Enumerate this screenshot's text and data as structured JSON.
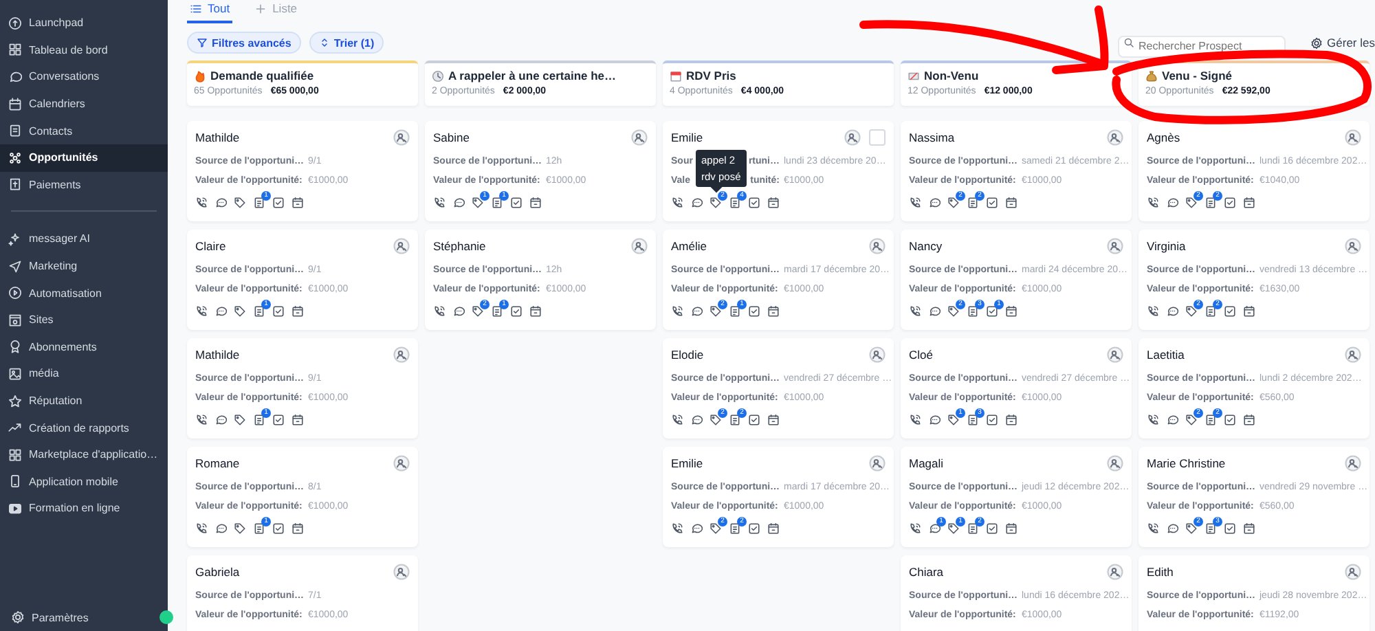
{
  "sidebar": {
    "groups": [
      [
        {
          "label": "Launchpad",
          "selected": false
        },
        {
          "label": "Tableau de bord",
          "selected": false
        },
        {
          "label": "Conversations",
          "selected": false
        },
        {
          "label": "Calendriers",
          "selected": false
        },
        {
          "label": "Contacts",
          "selected": false
        },
        {
          "label": "Opportunités",
          "selected": true
        },
        {
          "label": "Paiements",
          "selected": false
        }
      ],
      [
        {
          "label": "messager AI",
          "selected": false
        },
        {
          "label": "Marketing",
          "selected": false
        },
        {
          "label": "Automatisation",
          "selected": false
        },
        {
          "label": "Sites",
          "selected": false
        },
        {
          "label": "Abonnements",
          "selected": false
        },
        {
          "label": "média",
          "selected": false
        },
        {
          "label": "Réputation",
          "selected": false
        },
        {
          "label": "Création de rapports",
          "selected": false
        },
        {
          "label": "Marketplace d'applicatio…",
          "selected": false
        },
        {
          "label": "Application mobile",
          "selected": false
        },
        {
          "label": "Formation en ligne",
          "selected": false
        }
      ]
    ],
    "footer": {
      "label": "Paramètres"
    }
  },
  "tabs": [
    {
      "label": "Tout",
      "selected": true
    },
    {
      "label": "Liste",
      "selected": false
    }
  ],
  "toolbar": {
    "filters": "Filtres avancés",
    "sort": "Trier (1)",
    "search": {
      "placeholder": "Rechercher Prospect"
    },
    "manage": "Gérer les"
  },
  "columns": [
    {
      "title": "Demande qualifiée",
      "count": "65 Opportunités",
      "amount": "€65 000,00",
      "color": "#f4d57e",
      "cards": [
        {
          "name": "Mathilde",
          "source_label": "Source de l'opportuni…",
          "source": "9/1",
          "value_label": "Valeur de l'opportunité:",
          "value": "€1000,00",
          "actions": [
            {
              "kind": "call"
            },
            {
              "kind": "message"
            },
            {
              "kind": "tag"
            },
            {
              "kind": "note",
              "badge": "1"
            },
            {
              "kind": "task"
            },
            {
              "kind": "appointment"
            }
          ]
        },
        {
          "name": "Claire",
          "source_label": "Source de l'opportuni…",
          "source": "9/1",
          "value_label": "Valeur de l'opportunité:",
          "value": "€1000,00",
          "actions": [
            {
              "kind": "call"
            },
            {
              "kind": "message"
            },
            {
              "kind": "tag"
            },
            {
              "kind": "note",
              "badge": "1"
            },
            {
              "kind": "task"
            },
            {
              "kind": "appointment"
            }
          ]
        },
        {
          "name": "Mathilde",
          "source_label": "Source de l'opportuni…",
          "source": "9/1",
          "value_label": "Valeur de l'opportunité:",
          "value": "€1000,00",
          "actions": [
            {
              "kind": "call"
            },
            {
              "kind": "message"
            },
            {
              "kind": "tag"
            },
            {
              "kind": "note",
              "badge": "1"
            },
            {
              "kind": "task"
            },
            {
              "kind": "appointment"
            }
          ]
        },
        {
          "name": "Romane",
          "source_label": "Source de l'opportuni…",
          "source": "8/1",
          "value_label": "Valeur de l'opportunité:",
          "value": "€1000,00",
          "actions": [
            {
              "kind": "call"
            },
            {
              "kind": "message"
            },
            {
              "kind": "tag"
            },
            {
              "kind": "note",
              "badge": "1"
            },
            {
              "kind": "task"
            },
            {
              "kind": "appointment"
            }
          ]
        },
        {
          "name": "Gabriela",
          "source_label": "Source de l'opportuni…",
          "source": "7/1",
          "value_label": "Valeur de l'opportunité:",
          "value": "€1000,00"
        }
      ]
    },
    {
      "title": "A rappeler à une certaine he…",
      "count": "2 Opportunités",
      "amount": "€2 000,00",
      "color": "#c9d0dc",
      "cards": [
        {
          "name": "Sabine",
          "source_label": "Source de l'opportuni…",
          "source": "12h",
          "value_label": "Valeur de l'opportunité:",
          "value": "€1000,00",
          "actions": [
            {
              "kind": "call"
            },
            {
              "kind": "message"
            },
            {
              "kind": "tag",
              "badge": "1"
            },
            {
              "kind": "note",
              "badge": "1"
            },
            {
              "kind": "task"
            },
            {
              "kind": "appointment"
            }
          ]
        },
        {
          "name": "Stéphanie",
          "source_label": "Source de l'opportuni…",
          "source": "12h",
          "value_label": "Valeur de l'opportunité:",
          "value": "€1000,00",
          "actions": [
            {
              "kind": "call"
            },
            {
              "kind": "message"
            },
            {
              "kind": "tag",
              "badge": "2"
            },
            {
              "kind": "note",
              "badge": "1"
            },
            {
              "kind": "task"
            },
            {
              "kind": "appointment"
            }
          ]
        }
      ]
    },
    {
      "title": "RDV Pris",
      "count": "4 Opportunités",
      "amount": "€4 000,00",
      "color": "#b9c8e6",
      "cards": [
        {
          "name": "Emilie",
          "checkbox": {
            "checked": false
          },
          "tooltip": [
            "appel 2",
            "rdv posé"
          ],
          "source_label": [
            "Sour",
            "rtuni…"
          ],
          "source": "lundi 23 décembre 20…",
          "value_label": [
            "Vale",
            "tunité:"
          ],
          "value": "€1000,00",
          "actions": [
            {
              "kind": "call"
            },
            {
              "kind": "message"
            },
            {
              "kind": "tag",
              "badge": "2"
            },
            {
              "kind": "note",
              "badge": "4"
            },
            {
              "kind": "task"
            },
            {
              "kind": "appointment"
            }
          ]
        },
        {
          "name": "Amélie",
          "source_label": "Source de l'opportuni…",
          "source": "mardi 17 décembre 20…",
          "value_label": "Valeur de l'opportunité:",
          "value": "€1000,00",
          "actions": [
            {
              "kind": "call"
            },
            {
              "kind": "message"
            },
            {
              "kind": "tag",
              "badge": "2"
            },
            {
              "kind": "note",
              "badge": "1"
            },
            {
              "kind": "task"
            },
            {
              "kind": "appointment"
            }
          ]
        },
        {
          "name": "Elodie",
          "source_label": "Source de l'opportuni…",
          "source": "vendredi 27 décembre …",
          "value_label": "Valeur de l'opportunité:",
          "value": "€1000,00",
          "actions": [
            {
              "kind": "call"
            },
            {
              "kind": "message"
            },
            {
              "kind": "tag",
              "badge": "2"
            },
            {
              "kind": "note",
              "badge": "2"
            },
            {
              "kind": "task"
            },
            {
              "kind": "appointment"
            }
          ]
        },
        {
          "name": "Emilie",
          "source_label": "Source de l'opportuni…",
          "source": "mardi 17 décembre 20…",
          "value_label": "Valeur de l'opportunité:",
          "value": "€1000,00",
          "actions": [
            {
              "kind": "call"
            },
            {
              "kind": "message"
            },
            {
              "kind": "tag",
              "badge": "2"
            },
            {
              "kind": "note",
              "badge": "2"
            },
            {
              "kind": "task"
            },
            {
              "kind": "appointment"
            }
          ]
        }
      ]
    },
    {
      "title": "Non-Venu",
      "count": "12 Opportunités",
      "amount": "€12 000,00",
      "color": "#b9c8e6",
      "cards": [
        {
          "name": "Nassima",
          "source_label": "Source de l'opportuni…",
          "source": "samedi 21 décembre 2…",
          "value_label": "Valeur de l'opportunité:",
          "value": "€1000,00",
          "actions": [
            {
              "kind": "call"
            },
            {
              "kind": "message"
            },
            {
              "kind": "tag",
              "badge": "2"
            },
            {
              "kind": "note",
              "badge": "2"
            },
            {
              "kind": "task"
            },
            {
              "kind": "appointment"
            }
          ]
        },
        {
          "name": "Nancy",
          "source_label": "Source de l'opportuni…",
          "source": "mardi 24 décembre 20…",
          "value_label": "Valeur de l'opportunité:",
          "value": "€1000,00",
          "actions": [
            {
              "kind": "call"
            },
            {
              "kind": "message"
            },
            {
              "kind": "tag",
              "badge": "2"
            },
            {
              "kind": "note",
              "badge": "3"
            },
            {
              "kind": "task",
              "badge": "1"
            },
            {
              "kind": "appointment"
            }
          ]
        },
        {
          "name": "Cloé",
          "source_label": "Source de l'opportuni…",
          "source": "vendredi 27 décembre …",
          "value_label": "Valeur de l'opportunité:",
          "value": "€1000,00",
          "actions": [
            {
              "kind": "call"
            },
            {
              "kind": "message"
            },
            {
              "kind": "tag",
              "badge": "1"
            },
            {
              "kind": "note",
              "badge": "3"
            },
            {
              "kind": "task"
            },
            {
              "kind": "appointment"
            }
          ]
        },
        {
          "name": "Magali",
          "source_label": "Source de l'opportuni…",
          "source": "jeudi 12 décembre 202…",
          "value_label": "Valeur de l'opportunité:",
          "value": "€1000,00",
          "actions": [
            {
              "kind": "call"
            },
            {
              "kind": "message",
              "badge": "1"
            },
            {
              "kind": "tag",
              "badge": "1"
            },
            {
              "kind": "note",
              "badge": "2"
            },
            {
              "kind": "task"
            },
            {
              "kind": "appointment"
            }
          ]
        },
        {
          "name": "Chiara",
          "source_label": "Source de l'opportuni…",
          "source": "lundi 16 décembre 202…",
          "value_label": "Valeur de l'opportunité:",
          "value": "€1000,00"
        }
      ]
    },
    {
      "title": "Venu - Signé",
      "count": "20 Opportunités",
      "amount": "€22 592,00",
      "color": "#f2c9a0",
      "cards": [
        {
          "name": "Agnès",
          "source_label": "Source de l'opportuni…",
          "source": "lundi 16 décembre 202…",
          "value_label": "Valeur de l'opportunité:",
          "value": "€1040,00",
          "actions": [
            {
              "kind": "call"
            },
            {
              "kind": "message"
            },
            {
              "kind": "tag",
              "badge": "2"
            },
            {
              "kind": "note",
              "badge": "2"
            },
            {
              "kind": "task"
            },
            {
              "kind": "appointment"
            }
          ]
        },
        {
          "name": "Virginia",
          "source_label": "Source de l'opportuni…",
          "source": "vendredi 13 décembre …",
          "value_label": "Valeur de l'opportunité:",
          "value": "€1630,00",
          "actions": [
            {
              "kind": "call"
            },
            {
              "kind": "message"
            },
            {
              "kind": "tag",
              "badge": "2"
            },
            {
              "kind": "note",
              "badge": "2"
            },
            {
              "kind": "task"
            },
            {
              "kind": "appointment"
            }
          ]
        },
        {
          "name": "Laetitia",
          "source_label": "Source de l'opportuni…",
          "source": "lundi 2 décembre 202…",
          "value_label": "Valeur de l'opportunité:",
          "value": "€560,00",
          "actions": [
            {
              "kind": "call"
            },
            {
              "kind": "message"
            },
            {
              "kind": "tag",
              "badge": "2"
            },
            {
              "kind": "note",
              "badge": "2"
            },
            {
              "kind": "task"
            },
            {
              "kind": "appointment"
            }
          ]
        },
        {
          "name": "Marie Christine",
          "source_label": "Source de l'opportuni…",
          "source": "vendredi 29 novembre …",
          "value_label": "Valeur de l'opportunité:",
          "value": "€560,00",
          "actions": [
            {
              "kind": "call"
            },
            {
              "kind": "message"
            },
            {
              "kind": "tag",
              "badge": "2"
            },
            {
              "kind": "note",
              "badge": "3"
            },
            {
              "kind": "task"
            },
            {
              "kind": "appointment"
            }
          ]
        },
        {
          "name": "Edith",
          "source_label": "Source de l'opportuni…",
          "source": "jeudi 28 novembre 202…",
          "value_label": "Valeur de l'opportunité:",
          "value": "€1192,00"
        }
      ]
    }
  ],
  "annotation": {
    "kind": "arrow-and-circle",
    "color": "#ff0000"
  }
}
